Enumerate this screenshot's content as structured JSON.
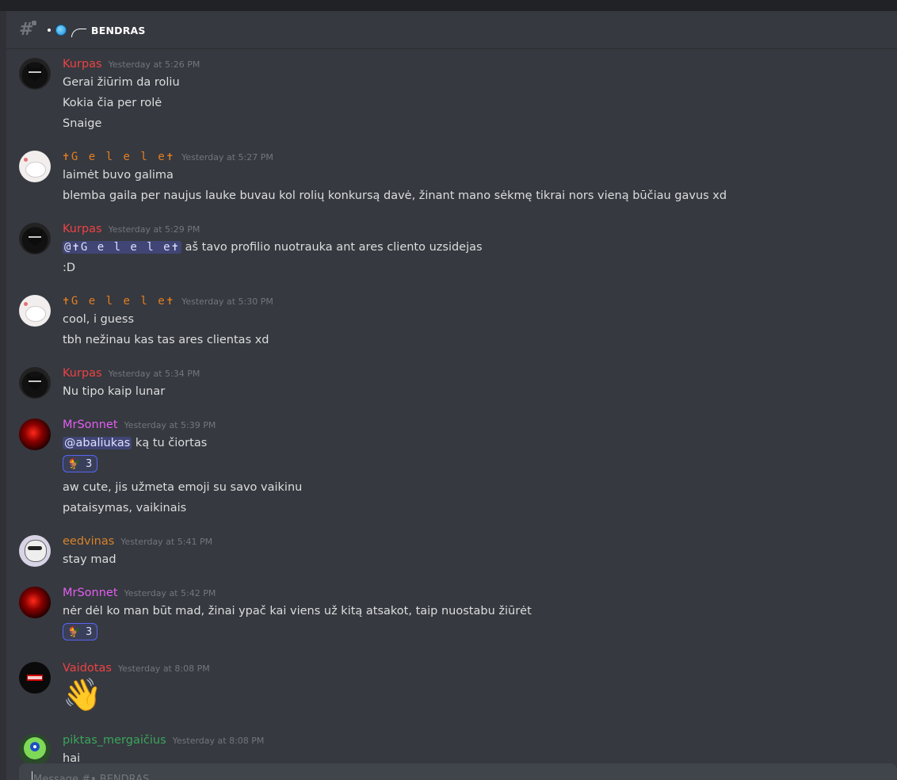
{
  "channel": {
    "name": "BENDRAS",
    "icons": [
      "hashtag-lock-icon",
      "globe-icon",
      "curve-icon"
    ]
  },
  "colors": {
    "kurpas": "#ed4245",
    "gelele": "#e67e22",
    "mrsonnet": "#e35ef2",
    "eedvinas": "#d9822b",
    "vaidotas": "#ed4245",
    "piktas": "#3ba55d",
    "mention_bg": "#5865f2"
  },
  "messages": [
    {
      "author": "Kurpas",
      "time": "Yesterday at 5:26 PM",
      "lines": [
        "Gerai žiūrim da roliu",
        "Kokia čia per rolė",
        "Snaige"
      ]
    },
    {
      "author": "✝G e l e l e✝",
      "time": "Yesterday at 5:27 PM",
      "lines": [
        "laimėt buvo galima",
        "blemba gaila per naujus lauke buvau kol rolių konkursą davė, žinant mano sėkmę tikrai nors vieną būčiau gavus xd"
      ]
    },
    {
      "author": "Kurpas",
      "time": "Yesterday at 5:29 PM",
      "mention": "@✝G e l e l e✝",
      "lines": [
        " aš tavo profilio nuotrauka ant ares cliento uzsidejas",
        ":D"
      ]
    },
    {
      "author": "✝G e l e l e✝",
      "time": "Yesterday at 5:30 PM",
      "lines": [
        "cool, i guess",
        "tbh nežinau kas tas ares clientas xd"
      ]
    },
    {
      "author": "Kurpas",
      "time": "Yesterday at 5:34 PM",
      "lines": [
        "Nu tipo kaip lunar"
      ]
    },
    {
      "author": "MrSonnet",
      "time": "Yesterday at 5:39 PM",
      "mention": "@abaliukas",
      "lines": [
        " ką tu čiortas",
        "aw cute, jis užmeta emoji su savo vaikinu",
        "pataisymas, vaikinais"
      ],
      "reaction": {
        "emoji": "rooster-icon",
        "count": "3"
      }
    },
    {
      "author": "eedvinas",
      "time": "Yesterday at 5:41 PM",
      "lines": [
        "stay mad"
      ]
    },
    {
      "author": "MrSonnet",
      "time": "Yesterday at 5:42 PM",
      "lines": [
        "nėr dėl ko man būt mad, žinai ypač kai viens už kitą atsakot, taip nuostabu žiūrėt"
      ],
      "reaction": {
        "emoji": "rooster-icon",
        "count": "3"
      }
    },
    {
      "author": "Vaidotas",
      "time": "Yesterday at 8:08 PM",
      "emoji": "waving-hand-icon"
    },
    {
      "author": "piktas_mergaičius",
      "time": "Yesterday at 8:08 PM",
      "lines": [
        "hai"
      ]
    }
  ],
  "composer": {
    "placeholder": "Message #• BENDRAS"
  }
}
